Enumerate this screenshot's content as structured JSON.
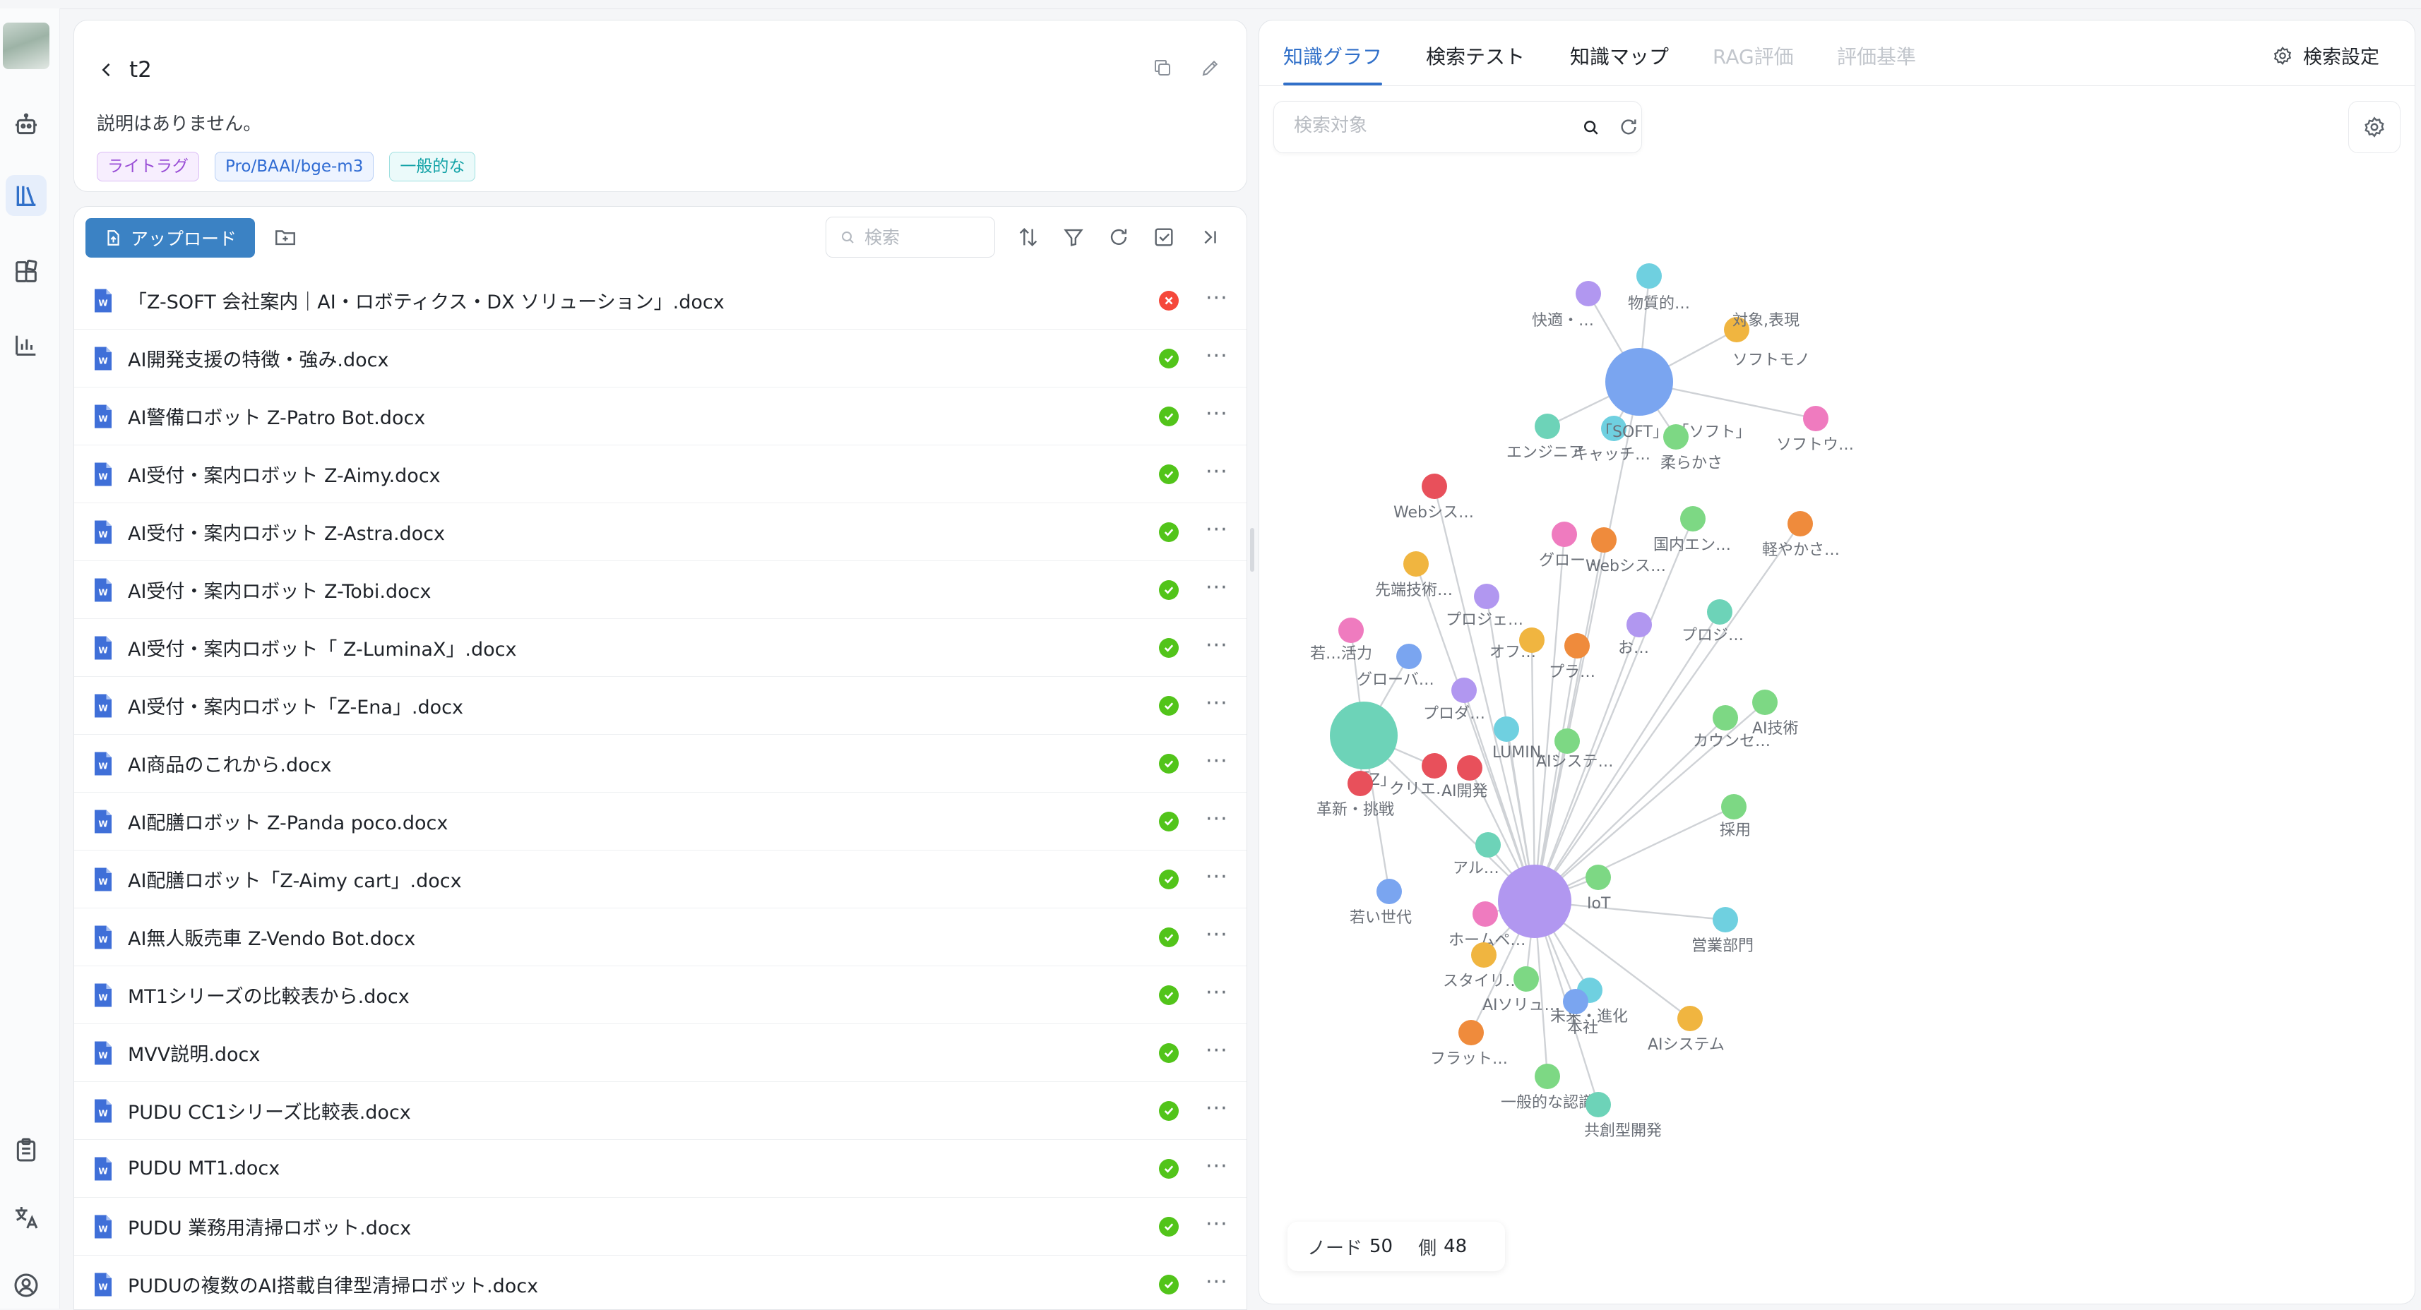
{
  "rail": {
    "items": [
      {
        "icon": "robot-icon"
      },
      {
        "icon": "library-icon",
        "active": true
      },
      {
        "icon": "apps-icon"
      },
      {
        "icon": "bar-chart-icon"
      },
      {
        "icon": "clipboard-icon"
      },
      {
        "icon": "translate-icon"
      },
      {
        "icon": "user-circle-icon"
      }
    ]
  },
  "kb": {
    "title": "t2",
    "description": "説明はありません。",
    "tags": [
      "ライトラグ",
      "Pro/BAAI/bge-m3",
      "一般的な"
    ]
  },
  "toolbar": {
    "upload_label": "アップロード",
    "search_placeholder": "検索"
  },
  "files": [
    {
      "name": "「Z-SOFT 会社案内｜AI・ロボティクス・DX ソリューション」.docx",
      "status": "error"
    },
    {
      "name": "AI開発支援の特徴・強み.docx",
      "status": "ok"
    },
    {
      "name": "AI警備ロボット Z-Patro Bot.docx",
      "status": "ok"
    },
    {
      "name": "AI受付・案内ロボット Z-Aimy.docx",
      "status": "ok"
    },
    {
      "name": "AI受付・案内ロボット Z-Astra.docx",
      "status": "ok"
    },
    {
      "name": "AI受付・案内ロボット Z-Tobi.docx",
      "status": "ok"
    },
    {
      "name": "AI受付・案内ロボット「 Z-LuminaX」.docx",
      "status": "ok"
    },
    {
      "name": "AI受付・案内ロボット「Z-Ena」.docx",
      "status": "ok"
    },
    {
      "name": "AI商品のこれから.docx",
      "status": "ok"
    },
    {
      "name": "AI配膳ロボット Z-Panda poco.docx",
      "status": "ok"
    },
    {
      "name": "AI配膳ロボット「Z-Aimy cart」.docx",
      "status": "ok"
    },
    {
      "name": "AI無人販売車 Z-Vendo Bot.docx",
      "status": "ok"
    },
    {
      "name": "MT1シリーズの比較表から.docx",
      "status": "ok"
    },
    {
      "name": "MVV説明.docx",
      "status": "ok"
    },
    {
      "name": "PUDU CC1シリーズ比較表.docx",
      "status": "ok"
    },
    {
      "name": "PUDU MT1.docx",
      "status": "ok"
    },
    {
      "name": "PUDU 業務用清掃ロボット.docx",
      "status": "ok"
    },
    {
      "name": "PUDUの複数のAI搭載自律型清掃ロボット.docx",
      "status": "ok"
    }
  ],
  "tabs": [
    {
      "label": "知識グラフ",
      "state": "active"
    },
    {
      "label": "検索テスト",
      "state": "normal"
    },
    {
      "label": "知識マップ",
      "state": "normal"
    },
    {
      "label": "RAG評価",
      "state": "disabled"
    },
    {
      "label": "評価基準",
      "state": "disabled"
    }
  ],
  "search_settings_label": "検索設定",
  "graph_search_placeholder": "検索対象",
  "stats": {
    "nodes_label": "ノード",
    "nodes": "50",
    "edges_label": "側",
    "edges": "48"
  },
  "graph": {
    "hubs": [
      {
        "id": "h1",
        "label": "",
        "color": "#b197f0"
      },
      {
        "id": "h2",
        "label": "",
        "color": "#7aa5f0"
      },
      {
        "id": "h3",
        "label": "「Z」",
        "color": "#6dd3b8"
      }
    ],
    "nodes": [
      {
        "label": "快適・…",
        "color": "#b197f0"
      },
      {
        "label": "物質的…",
        "color": "#6fd0e0"
      },
      {
        "label": "対象,表現",
        "color": "#f0b540"
      },
      {
        "label": "ソフトモノ",
        "color": ""
      },
      {
        "label": "ソフトウ…",
        "color": "#ef7bbf"
      },
      {
        "label": "エンジニア",
        "color": "#6dd3b8"
      },
      {
        "label": "キャッチ…",
        "color": "#6fd0e0"
      },
      {
        "label": "「SOFT」/「ソフト」",
        "color": ""
      },
      {
        "label": "柔らかさ",
        "color": "#7dd884"
      },
      {
        "label": "軽やかさ…",
        "color": "#ef8b3c"
      },
      {
        "label": "Webシス…",
        "color": "#e8505b"
      },
      {
        "label": "グロー…",
        "color": "#ef7bbf"
      },
      {
        "label": "Webシス…",
        "color": "#ef8b3c"
      },
      {
        "label": "国内エン…",
        "color": "#7dd884"
      },
      {
        "label": "先端技術…",
        "color": "#f0b540"
      },
      {
        "label": "プロジェ…",
        "color": "#b197f0"
      },
      {
        "label": "お…",
        "color": "#b197f0"
      },
      {
        "label": "プロジ…",
        "color": "#6dd3b8"
      },
      {
        "label": "若…活力",
        "color": "#ef7bbf"
      },
      {
        "label": "グローバ…",
        "color": "#7aa5f0"
      },
      {
        "label": "プロダ…",
        "color": "#b197f0"
      },
      {
        "label": "LUMIN…",
        "color": "#6fd0e0"
      },
      {
        "label": "オフ…",
        "color": "#f0b540"
      },
      {
        "label": "プラ…",
        "color": "#ef8b3c"
      },
      {
        "label": "AI技術",
        "color": "#7dd884"
      },
      {
        "label": "カウンセ…",
        "color": "#7dd884"
      },
      {
        "label": "革新・挑戦",
        "color": "#e8505b"
      },
      {
        "label": "AIシステ…",
        "color": "#7dd884"
      },
      {
        "label": "AI開発",
        "color": "#e8505b"
      },
      {
        "label": "クリエ…",
        "color": "#e8505b"
      },
      {
        "label": "採用",
        "color": "#7dd884"
      },
      {
        "label": "アル…",
        "color": "#6dd3b8"
      },
      {
        "label": "若い世代",
        "color": "#7aa5f0"
      },
      {
        "label": "IoT",
        "color": "#7dd884"
      },
      {
        "label": "ホームペ…",
        "color": "#ef7bbf"
      },
      {
        "label": "スタイリ…",
        "color": "#f0b540"
      },
      {
        "label": "未来・進化",
        "color": "#6fd0e0"
      },
      {
        "label": "営業部門",
        "color": "#6fd0e0"
      },
      {
        "label": "AIソリュ…",
        "color": "#7dd884"
      },
      {
        "label": "本社",
        "color": "#7aa5f0"
      },
      {
        "label": "AIシステム",
        "color": "#f0b540"
      },
      {
        "label": "フラット…",
        "color": "#ef8b3c"
      },
      {
        "label": "一般的な認識",
        "color": "#7dd884"
      },
      {
        "label": "共創型開発",
        "color": "#6dd3b8"
      }
    ]
  }
}
